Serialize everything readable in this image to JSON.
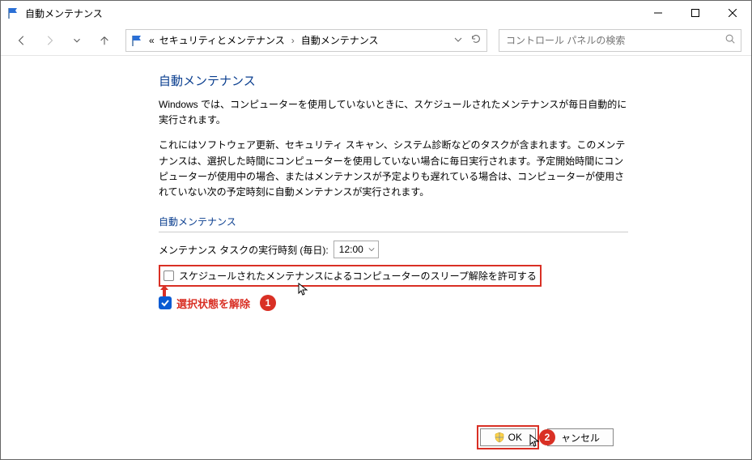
{
  "window": {
    "title": "自動メンテナンス"
  },
  "breadcrumb": {
    "prefix": "«",
    "item1": "セキュリティとメンテナンス",
    "item2": "自動メンテナンス"
  },
  "search": {
    "placeholder": "コントロール パネルの検索"
  },
  "page": {
    "heading": "自動メンテナンス",
    "para1": "Windows では、コンピューターを使用していないときに、スケジュールされたメンテナンスが毎日自動的に実行されます。",
    "para2": "これにはソフトウェア更新、セキュリティ スキャン、システム診断などのタスクが含まれます。このメンテナンスは、選択した時間にコンピューターを使用していない場合に毎日実行されます。予定開始時間にコンピューターが使用中の場合、またはメンテナンスが予定よりも遅れている場合は、コンピューターが使用されていない次の予定時刻に自動メンテナンスが実行されます。",
    "section": "自動メンテナンス",
    "time_label": "メンテナンス タスクの実行時刻 (毎日):",
    "time_value": "12:00",
    "checkbox_label": "スケジュールされたメンテナンスによるコンピューターのスリープ解除を許可する"
  },
  "annotations": {
    "step1_text": "選択状態を解除",
    "step1_num": "1",
    "step2_num": "2"
  },
  "buttons": {
    "ok": "OK",
    "cancel": "ャンセル"
  }
}
